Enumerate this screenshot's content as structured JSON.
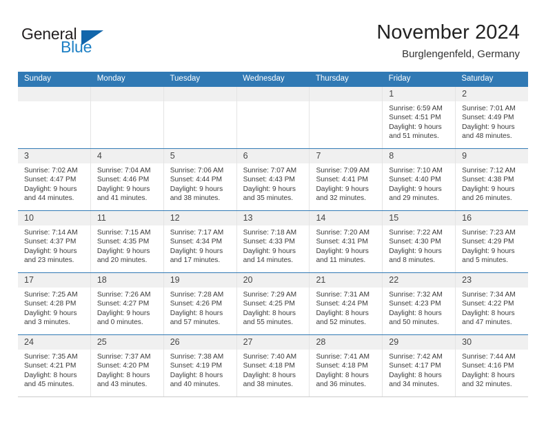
{
  "brand": {
    "name_part1": "General",
    "name_part2": "Blue",
    "triangle_color": "#1266ab",
    "blue_color": "#1c7fc4"
  },
  "header": {
    "title": "November 2024",
    "subtitle": "Burglengenfeld, Germany",
    "accent_color": "#3079b4"
  },
  "weekdays": [
    {
      "label": "Sunday"
    },
    {
      "label": "Monday"
    },
    {
      "label": "Tuesday"
    },
    {
      "label": "Wednesday"
    },
    {
      "label": "Thursday"
    },
    {
      "label": "Friday"
    },
    {
      "label": "Saturday"
    }
  ],
  "weeks": [
    [
      {
        "day": "",
        "empty": true
      },
      {
        "day": "",
        "empty": true
      },
      {
        "day": "",
        "empty": true
      },
      {
        "day": "",
        "empty": true
      },
      {
        "day": "",
        "empty": true
      },
      {
        "day": "1",
        "sunrise": "Sunrise: 6:59 AM",
        "sunset": "Sunset: 4:51 PM",
        "daylight1": "Daylight: 9 hours",
        "daylight2": "and 51 minutes."
      },
      {
        "day": "2",
        "sunrise": "Sunrise: 7:01 AM",
        "sunset": "Sunset: 4:49 PM",
        "daylight1": "Daylight: 9 hours",
        "daylight2": "and 48 minutes."
      }
    ],
    [
      {
        "day": "3",
        "sunrise": "Sunrise: 7:02 AM",
        "sunset": "Sunset: 4:47 PM",
        "daylight1": "Daylight: 9 hours",
        "daylight2": "and 44 minutes."
      },
      {
        "day": "4",
        "sunrise": "Sunrise: 7:04 AM",
        "sunset": "Sunset: 4:46 PM",
        "daylight1": "Daylight: 9 hours",
        "daylight2": "and 41 minutes."
      },
      {
        "day": "5",
        "sunrise": "Sunrise: 7:06 AM",
        "sunset": "Sunset: 4:44 PM",
        "daylight1": "Daylight: 9 hours",
        "daylight2": "and 38 minutes."
      },
      {
        "day": "6",
        "sunrise": "Sunrise: 7:07 AM",
        "sunset": "Sunset: 4:43 PM",
        "daylight1": "Daylight: 9 hours",
        "daylight2": "and 35 minutes."
      },
      {
        "day": "7",
        "sunrise": "Sunrise: 7:09 AM",
        "sunset": "Sunset: 4:41 PM",
        "daylight1": "Daylight: 9 hours",
        "daylight2": "and 32 minutes."
      },
      {
        "day": "8",
        "sunrise": "Sunrise: 7:10 AM",
        "sunset": "Sunset: 4:40 PM",
        "daylight1": "Daylight: 9 hours",
        "daylight2": "and 29 minutes."
      },
      {
        "day": "9",
        "sunrise": "Sunrise: 7:12 AM",
        "sunset": "Sunset: 4:38 PM",
        "daylight1": "Daylight: 9 hours",
        "daylight2": "and 26 minutes."
      }
    ],
    [
      {
        "day": "10",
        "sunrise": "Sunrise: 7:14 AM",
        "sunset": "Sunset: 4:37 PM",
        "daylight1": "Daylight: 9 hours",
        "daylight2": "and 23 minutes."
      },
      {
        "day": "11",
        "sunrise": "Sunrise: 7:15 AM",
        "sunset": "Sunset: 4:35 PM",
        "daylight1": "Daylight: 9 hours",
        "daylight2": "and 20 minutes."
      },
      {
        "day": "12",
        "sunrise": "Sunrise: 7:17 AM",
        "sunset": "Sunset: 4:34 PM",
        "daylight1": "Daylight: 9 hours",
        "daylight2": "and 17 minutes."
      },
      {
        "day": "13",
        "sunrise": "Sunrise: 7:18 AM",
        "sunset": "Sunset: 4:33 PM",
        "daylight1": "Daylight: 9 hours",
        "daylight2": "and 14 minutes."
      },
      {
        "day": "14",
        "sunrise": "Sunrise: 7:20 AM",
        "sunset": "Sunset: 4:31 PM",
        "daylight1": "Daylight: 9 hours",
        "daylight2": "and 11 minutes."
      },
      {
        "day": "15",
        "sunrise": "Sunrise: 7:22 AM",
        "sunset": "Sunset: 4:30 PM",
        "daylight1": "Daylight: 9 hours",
        "daylight2": "and 8 minutes."
      },
      {
        "day": "16",
        "sunrise": "Sunrise: 7:23 AM",
        "sunset": "Sunset: 4:29 PM",
        "daylight1": "Daylight: 9 hours",
        "daylight2": "and 5 minutes."
      }
    ],
    [
      {
        "day": "17",
        "sunrise": "Sunrise: 7:25 AM",
        "sunset": "Sunset: 4:28 PM",
        "daylight1": "Daylight: 9 hours",
        "daylight2": "and 3 minutes."
      },
      {
        "day": "18",
        "sunrise": "Sunrise: 7:26 AM",
        "sunset": "Sunset: 4:27 PM",
        "daylight1": "Daylight: 9 hours",
        "daylight2": "and 0 minutes."
      },
      {
        "day": "19",
        "sunrise": "Sunrise: 7:28 AM",
        "sunset": "Sunset: 4:26 PM",
        "daylight1": "Daylight: 8 hours",
        "daylight2": "and 57 minutes."
      },
      {
        "day": "20",
        "sunrise": "Sunrise: 7:29 AM",
        "sunset": "Sunset: 4:25 PM",
        "daylight1": "Daylight: 8 hours",
        "daylight2": "and 55 minutes."
      },
      {
        "day": "21",
        "sunrise": "Sunrise: 7:31 AM",
        "sunset": "Sunset: 4:24 PM",
        "daylight1": "Daylight: 8 hours",
        "daylight2": "and 52 minutes."
      },
      {
        "day": "22",
        "sunrise": "Sunrise: 7:32 AM",
        "sunset": "Sunset: 4:23 PM",
        "daylight1": "Daylight: 8 hours",
        "daylight2": "and 50 minutes."
      },
      {
        "day": "23",
        "sunrise": "Sunrise: 7:34 AM",
        "sunset": "Sunset: 4:22 PM",
        "daylight1": "Daylight: 8 hours",
        "daylight2": "and 47 minutes."
      }
    ],
    [
      {
        "day": "24",
        "sunrise": "Sunrise: 7:35 AM",
        "sunset": "Sunset: 4:21 PM",
        "daylight1": "Daylight: 8 hours",
        "daylight2": "and 45 minutes."
      },
      {
        "day": "25",
        "sunrise": "Sunrise: 7:37 AM",
        "sunset": "Sunset: 4:20 PM",
        "daylight1": "Daylight: 8 hours",
        "daylight2": "and 43 minutes."
      },
      {
        "day": "26",
        "sunrise": "Sunrise: 7:38 AM",
        "sunset": "Sunset: 4:19 PM",
        "daylight1": "Daylight: 8 hours",
        "daylight2": "and 40 minutes."
      },
      {
        "day": "27",
        "sunrise": "Sunrise: 7:40 AM",
        "sunset": "Sunset: 4:18 PM",
        "daylight1": "Daylight: 8 hours",
        "daylight2": "and 38 minutes."
      },
      {
        "day": "28",
        "sunrise": "Sunrise: 7:41 AM",
        "sunset": "Sunset: 4:18 PM",
        "daylight1": "Daylight: 8 hours",
        "daylight2": "and 36 minutes."
      },
      {
        "day": "29",
        "sunrise": "Sunrise: 7:42 AM",
        "sunset": "Sunset: 4:17 PM",
        "daylight1": "Daylight: 8 hours",
        "daylight2": "and 34 minutes."
      },
      {
        "day": "30",
        "sunrise": "Sunrise: 7:44 AM",
        "sunset": "Sunset: 4:16 PM",
        "daylight1": "Daylight: 8 hours",
        "daylight2": "and 32 minutes."
      }
    ]
  ]
}
